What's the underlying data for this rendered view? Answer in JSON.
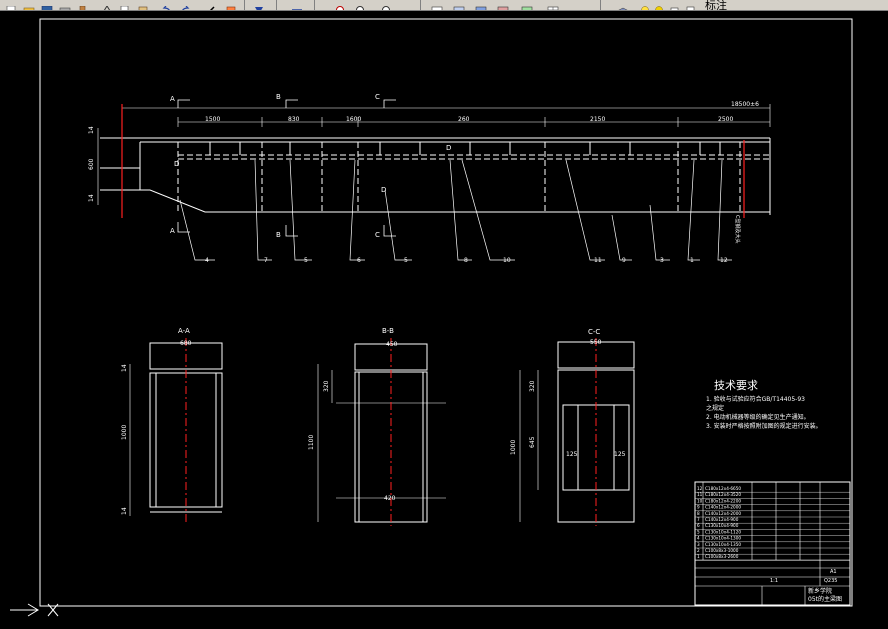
{
  "toolbar": {
    "layer_label": "标注",
    "icons": [
      "new-icon",
      "open-icon",
      "save-icon",
      "print-icon",
      "cut-icon",
      "copy-icon",
      "paste-icon",
      "brush-icon",
      "undo-icon",
      "redo-icon",
      "pan-icon",
      "zoom-icon",
      "zoom-window-icon",
      "properties-icon",
      "text-style-icon",
      "dim-style-icon",
      "table-icon",
      "layer-icon",
      "light-bulb-icon",
      "freeze-icon"
    ]
  },
  "drawing": {
    "section_markers": {
      "a": "A",
      "b": "B",
      "c": "C"
    },
    "overall_dim": "18500±6",
    "top_dims": [
      "1500",
      "830",
      "1600",
      "260",
      "2150",
      "2500"
    ],
    "side_dims": {
      "top": "14",
      "mid": "600",
      "bottom": "14"
    },
    "d_marks": [
      "D",
      "D",
      "D"
    ],
    "part_numbers": [
      "4",
      "7",
      "5",
      "6",
      "5",
      "8",
      "10",
      "11",
      "9",
      "3",
      "1",
      "12"
    ],
    "right_vertical_text": "C型钢及大头",
    "views": {
      "aa": {
        "title": "A-A",
        "width": "680",
        "height": "1000",
        "top": "14",
        "bottom": "14"
      },
      "bb": {
        "title": "B-B",
        "width": "450",
        "height": "1100",
        "small": "320",
        "inner": "420",
        "bottom": "14"
      },
      "cc": {
        "title": "C-C",
        "width": "550",
        "height": "1000",
        "upper": "320",
        "lower": "645",
        "left": "125",
        "right": "125"
      }
    }
  },
  "tech": {
    "title": "技术要求",
    "items": [
      "1. 验收与试验应符合GB/T14405-93",
      "之规定",
      "2. 电动机械器等级的确定见生产通知。",
      "3. 安装时严格按照附加图的规定进行安装。"
    ]
  },
  "title_block": {
    "rows": [
      [
        "12",
        "C180x12x4-6650",
        "",
        ""
      ],
      [
        "11",
        "C180x12x4-3520",
        "",
        ""
      ],
      [
        "10",
        "C180x12x4-2200",
        "",
        ""
      ],
      [
        "9",
        "C140x12x4-2000",
        "",
        ""
      ],
      [
        "8",
        "C140x12x4-2000",
        "",
        ""
      ],
      [
        "7",
        "C140x12x4-900",
        "",
        ""
      ],
      [
        "6",
        "C130x10x4-900",
        "",
        ""
      ],
      [
        "5",
        "C130x10x4-1120",
        "",
        ""
      ],
      [
        "4",
        "C130x10x4-1300",
        "",
        ""
      ],
      [
        "3",
        "C130x10x4-1350",
        "",
        ""
      ],
      [
        "2",
        "C100x8x3-1000",
        "",
        ""
      ],
      [
        "1",
        "C100x8x3-2600",
        "",
        ""
      ]
    ],
    "company": "新乡学院",
    "drawing_name": "05t的主梁图",
    "material": "Q235",
    "scale": "1:1",
    "sheet": "A1"
  }
}
